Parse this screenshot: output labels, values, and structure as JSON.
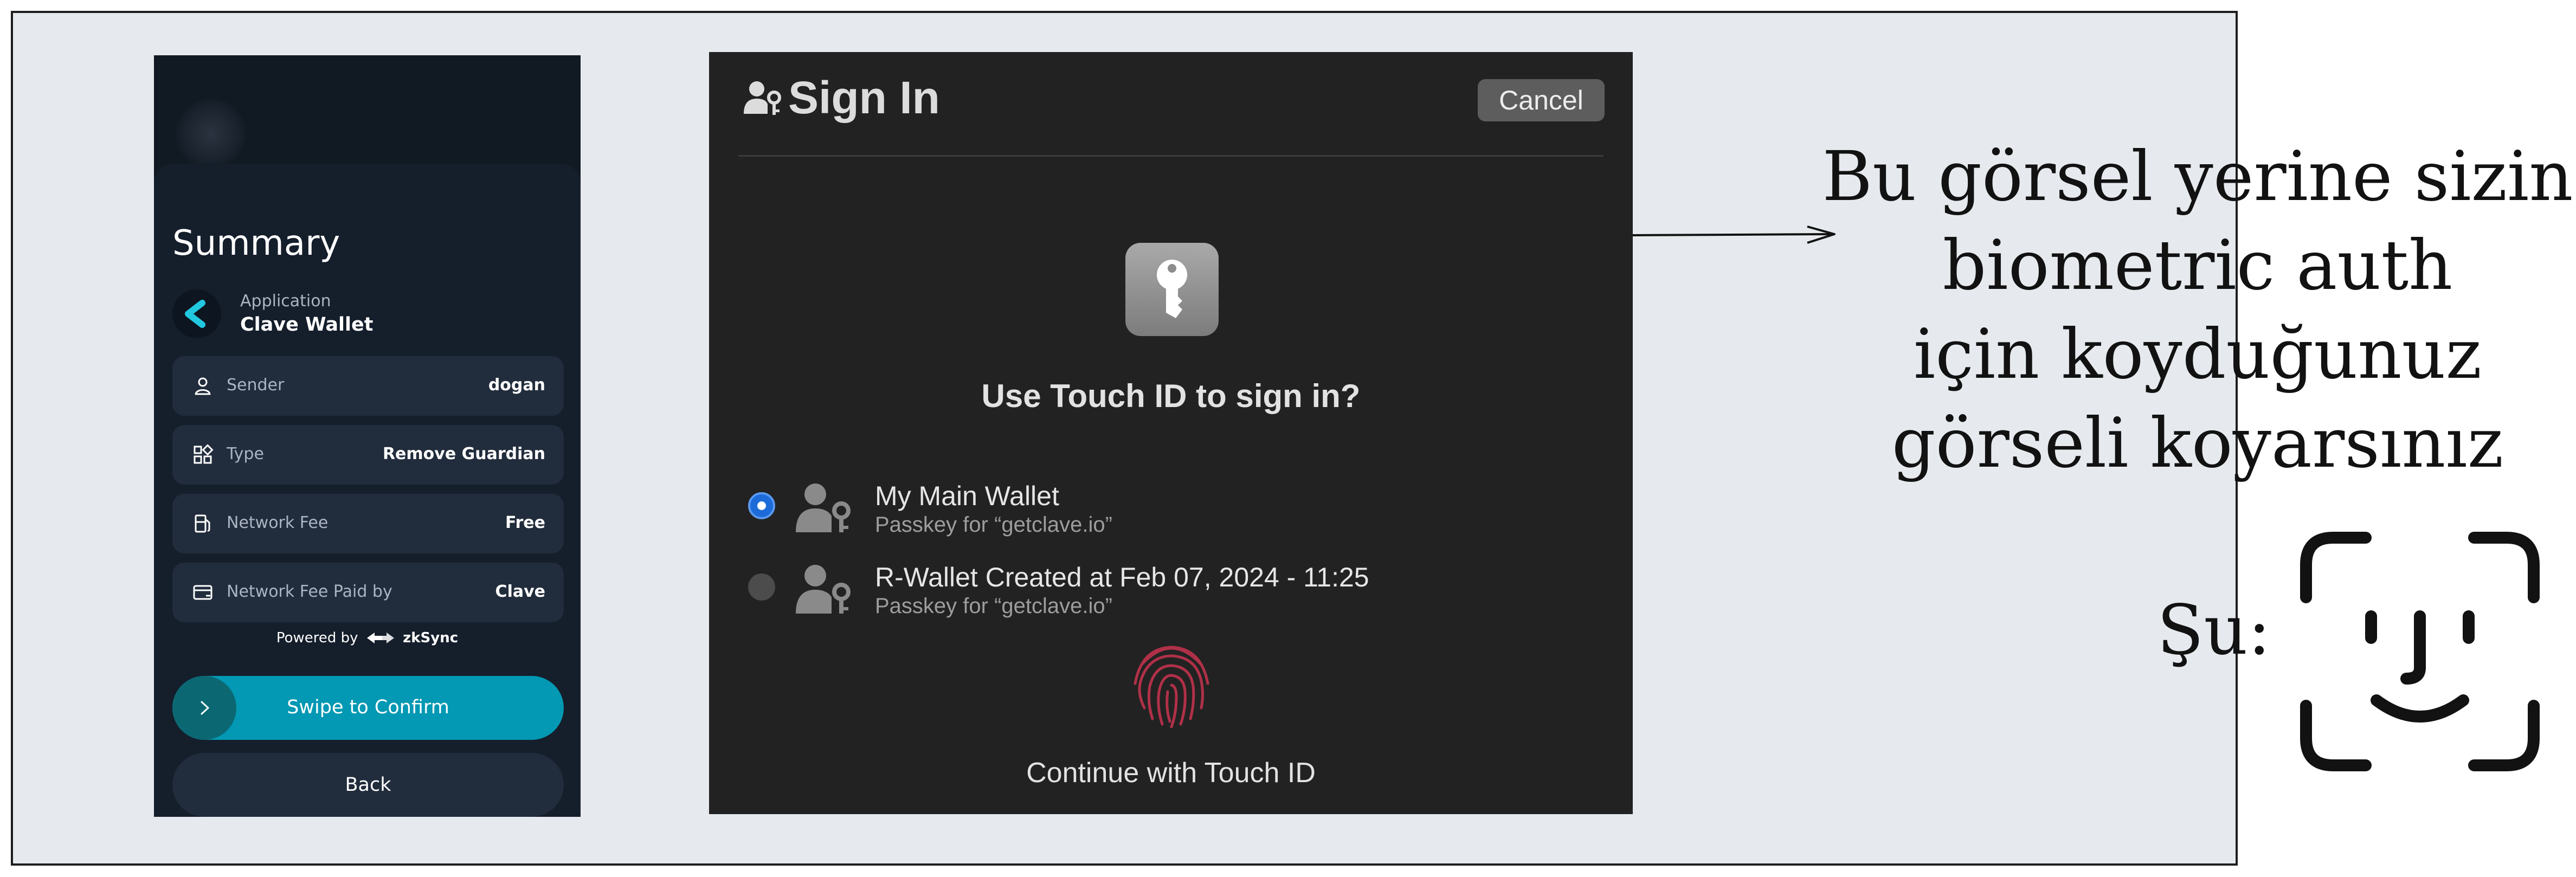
{
  "mobile": {
    "summary_title": "Summary",
    "application_label": "Application",
    "application_name": "Clave Wallet",
    "rows": [
      {
        "icon": "user-icon",
        "label": "Sender",
        "value": "dogan"
      },
      {
        "icon": "grid-icon",
        "label": "Type",
        "value": "Remove Guardian"
      },
      {
        "icon": "gas-pump-icon",
        "label": "Network Fee",
        "value": "Free"
      },
      {
        "icon": "credit-card-icon",
        "label": "Network Fee Paid by",
        "value": "Clave"
      }
    ],
    "powered_by": "Powered by",
    "powered_brand": "zkSync",
    "swipe_label": "Swipe to Confirm",
    "back_label": "Back"
  },
  "dialog": {
    "title": "Sign In",
    "cancel_label": "Cancel",
    "prompt": "Use Touch ID to sign in?",
    "accounts": [
      {
        "name": "My Main Wallet",
        "subtitle": "Passkey for “getclave.io”",
        "selected": true
      },
      {
        "name": "R-Wallet Created at Feb 07, 2024 - 11:25",
        "subtitle": "Passkey for “getclave.io”",
        "selected": false
      }
    ],
    "continue_label": "Continue with Touch ID"
  },
  "annotation": {
    "lines": [
      "Bu görsel yerine sizin",
      "biometric auth",
      "için koyduğunuz",
      "görseli koyarsınız"
    ],
    "su_label": "Şu:"
  },
  "colors": {
    "frame_bg": "#e6eaee",
    "mobile_bg": "#111923",
    "row_bg": "#212c3c",
    "swipe_accent": "#0398b3",
    "dialog_bg": "#222222",
    "radio_selected": "#1c6bd9",
    "fingerprint": "#b03048"
  }
}
